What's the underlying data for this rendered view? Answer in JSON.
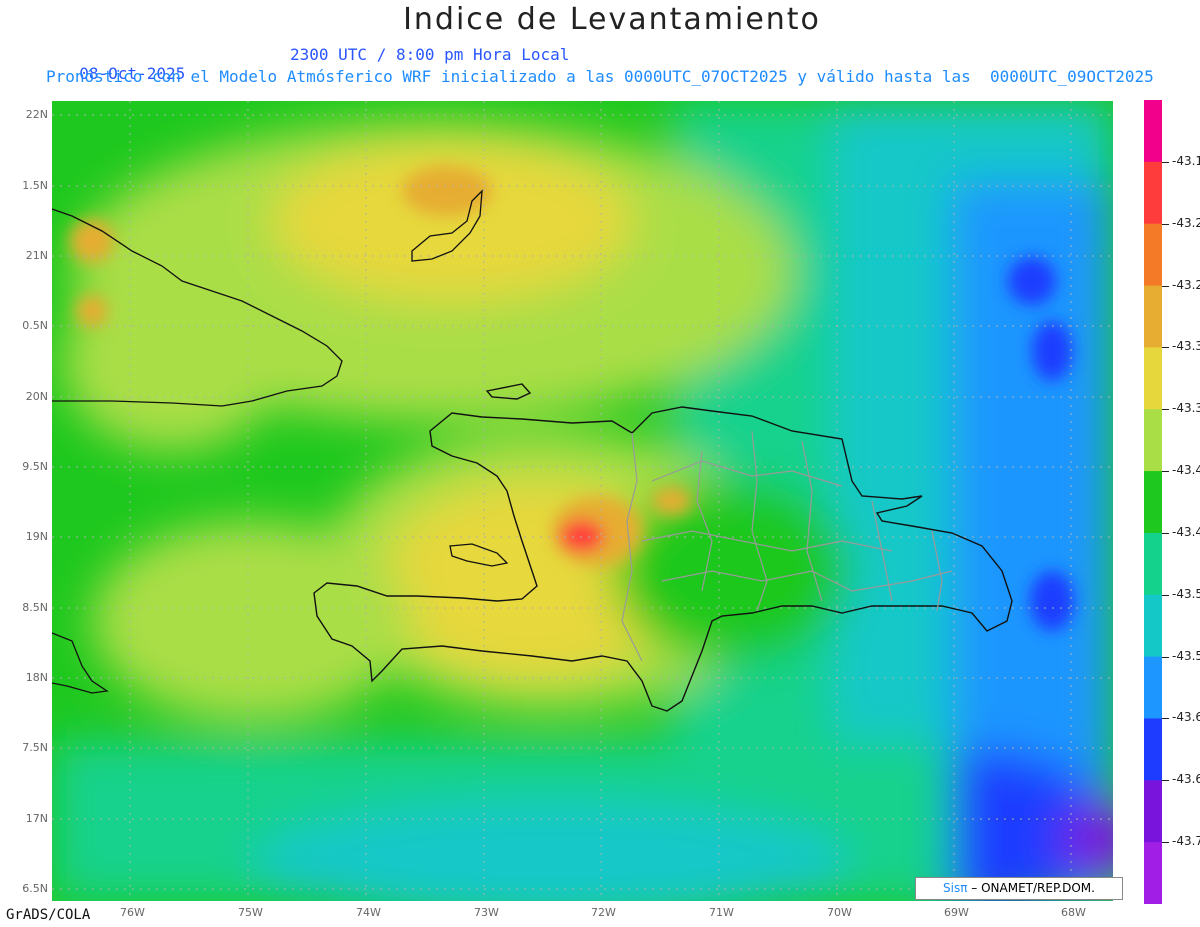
{
  "title": "Indice de Levantamiento",
  "date": "08-Oct-2025",
  "time": "2300 UTC / 8:00 pm Hora Local",
  "subtitle": "Pronóstico con el Modelo Atmósferico WRF inicializado a las 0000UTC_07OCT2025 y válido hasta las  0000UTC_09OCT2025",
  "lat_labels": [
    "22N",
    "1.5N",
    "21N",
    "0.5N",
    "20N",
    "9.5N",
    "19N",
    "8.5N",
    "18N",
    "7.5N",
    "17N",
    "6.5N"
  ],
  "lon_labels": [
    "76W",
    "75W",
    "74W",
    "73W",
    "72W",
    "71W",
    "70W",
    "69W",
    "68W"
  ],
  "footer_left": "GrADS/COLA",
  "credit": {
    "logo": "Sisπ",
    "text": "– ONAMET/REP.DOM."
  },
  "colorbar": {
    "labels": [
      "-43.1",
      "-43.2",
      "-43.2",
      "-43.3",
      "-43.3",
      "-43.4",
      "-43.4",
      "-43.5",
      "-43.5",
      "-43.6",
      "-43.6",
      "-43.7"
    ],
    "colors": [
      "#f2008c",
      "#ff3c3c",
      "#f57a28",
      "#e6ad32",
      "#e6d83c",
      "#aade46",
      "#1ec81e",
      "#14d28c",
      "#14c8c8",
      "#1e96ff",
      "#1e3cff",
      "#7814dc",
      "#a01ee6"
    ]
  },
  "map_colors": {
    "ocean_low": "#1e96ff",
    "land_high": "#f2008c",
    "mid": "#7fd23c"
  }
}
